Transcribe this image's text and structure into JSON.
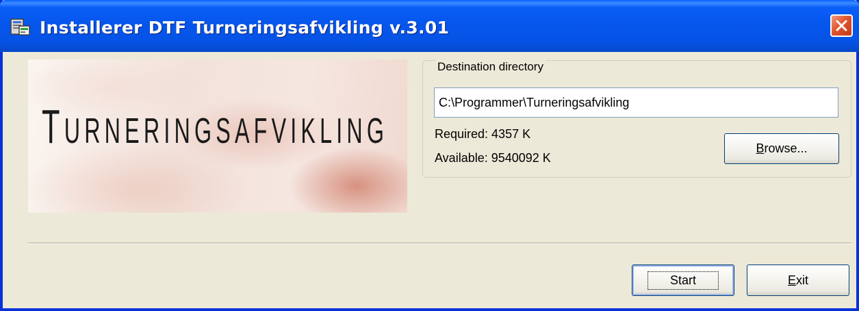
{
  "window": {
    "title": "Installerer DTF Turneringsafvikling v.3.01",
    "title_icon": "installer-icon",
    "close_icon": "close-icon"
  },
  "banner": {
    "first_letter": "T",
    "rest": "URNERINGSAFVIKLING"
  },
  "destination": {
    "legend": "Destination directory",
    "path": "C:\\Programmer\\Turneringsafvikling",
    "required": "Required: 4357 K",
    "available": "Available: 9540092 K",
    "browse_pre": "",
    "browse_u": "B",
    "browse_post": "rowse..."
  },
  "buttons": {
    "start": "Start",
    "exit_u": "E",
    "exit_post": "xit"
  },
  "colors": {
    "titlebar": "#0654e6",
    "face": "#ece9d8",
    "close": "#e0552e"
  }
}
